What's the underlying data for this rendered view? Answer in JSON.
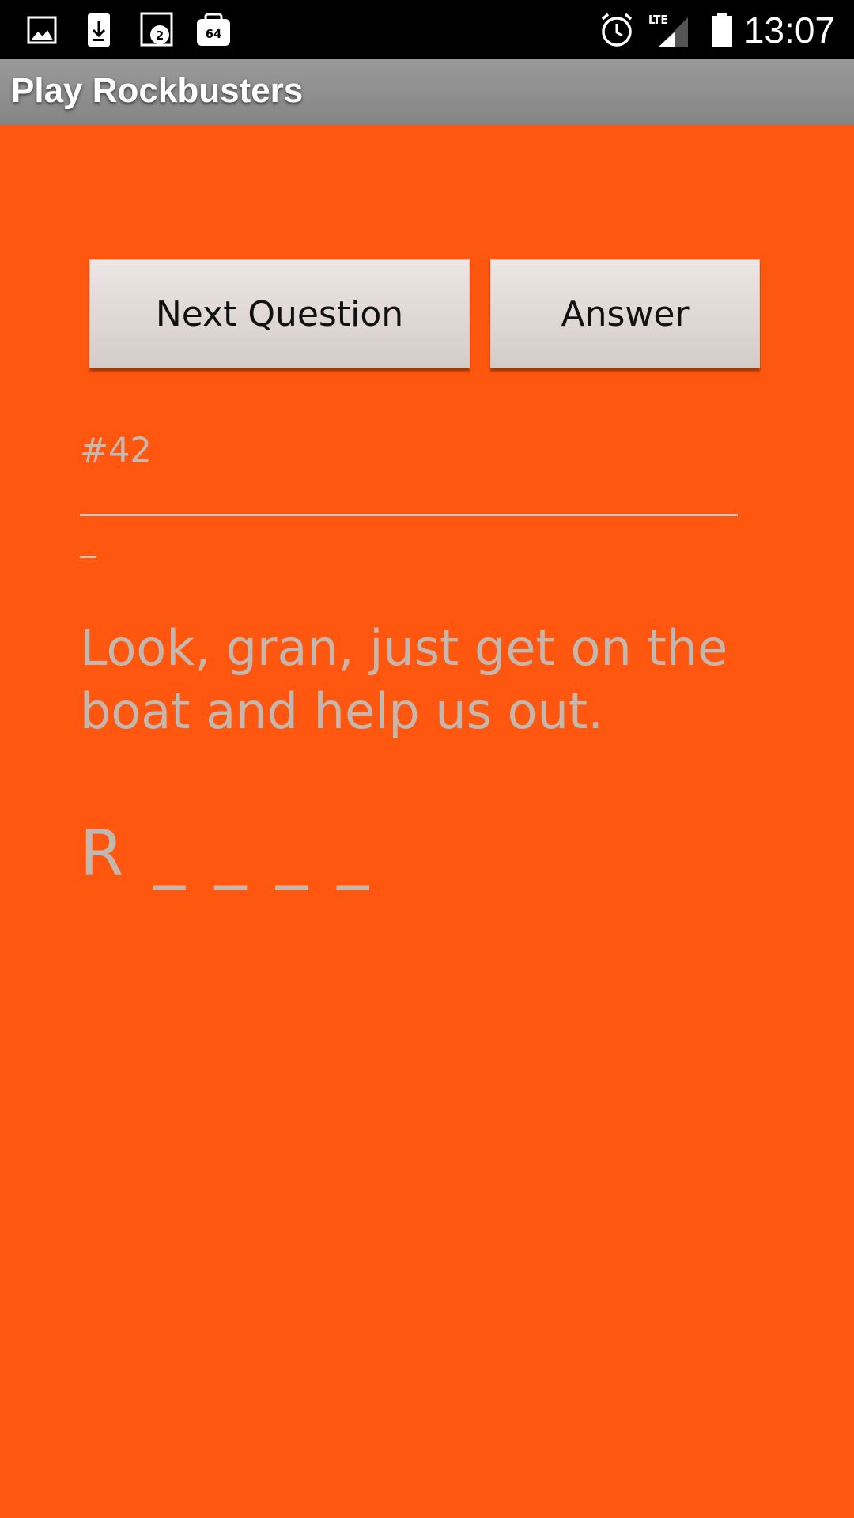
{
  "status_bar": {
    "time": "13:07",
    "icons": [
      "image-icon",
      "download-icon",
      "notification-2-icon",
      "badge-64-icon",
      "alarm-icon",
      "lte-signal-icon",
      "battery-icon"
    ],
    "notif_count_a": "2",
    "notif_count_b": "64",
    "network": "LTE"
  },
  "action_bar": {
    "title": "Play Rockbusters"
  },
  "buttons": {
    "next_label": "Next Question",
    "answer_label": "Answer"
  },
  "question": {
    "number": "#42",
    "text": "Look, gran, just get on the boat and help us out.",
    "hint": "R _ _ _ _"
  },
  "colors": {
    "background": "#ff5610",
    "text_muted": "#c3b7ae",
    "button_face": "#e3dcd9"
  }
}
